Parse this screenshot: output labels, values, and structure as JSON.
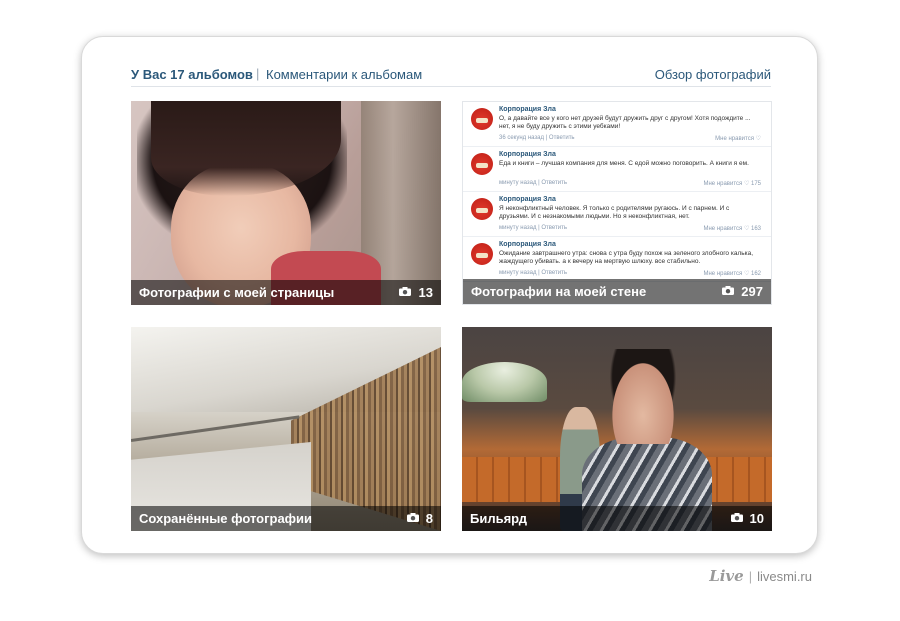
{
  "header": {
    "albums_title": "У Вас 17 альбомов",
    "separator": "|",
    "comments_link": "Комментарии к альбомам",
    "overview_link": "Обзор фотографий"
  },
  "albums": [
    {
      "title": "Фотографии с моей страницы",
      "count": "13"
    },
    {
      "title": "Фотографии на моей стене",
      "count": "297"
    },
    {
      "title": "Сохранённые фотографии",
      "count": "8"
    },
    {
      "title": "Бильярд",
      "count": "10"
    }
  ],
  "wall_posts": [
    {
      "author": "Корпорация Зла",
      "text": "О, а давайте все у кого нет друзей будут дружить друг с другом! Хотя подождите ... нет, я не буду дружить с этими уебками!",
      "meta": "36 секунд назад | Ответить",
      "like": "Мне нравится ♡"
    },
    {
      "author": "Корпорация Зла",
      "text": "Еда и книги – лучшая компания для меня. С едой можно поговорить. А книги я ем.",
      "meta": "минуту назад | Ответить",
      "like": "Мне нравится ♡ 175"
    },
    {
      "author": "Корпорация Зла",
      "text": "Я неконфликтный человек. Я только с родителями ругаюсь. И с парнем. И с друзьями. И с незнакомыми людьми. Но я неконфликтная, нет.",
      "meta": "минуту назад | Ответить",
      "like": "Мне нравится ♡ 163"
    },
    {
      "author": "Корпорация Зла",
      "text": "Ожидание завтрашнего утра: снова с утра буду похож на зеленого злобного калька, жаждущего убивать. а к вечеру на мертвую шлюху. все стабильно.",
      "meta": "минуту назад | Ответить",
      "like": "Мне нравится ♡ 162"
    }
  ],
  "footer": {
    "logo": "Live",
    "separator": "|",
    "site": "livesmi.ru"
  }
}
